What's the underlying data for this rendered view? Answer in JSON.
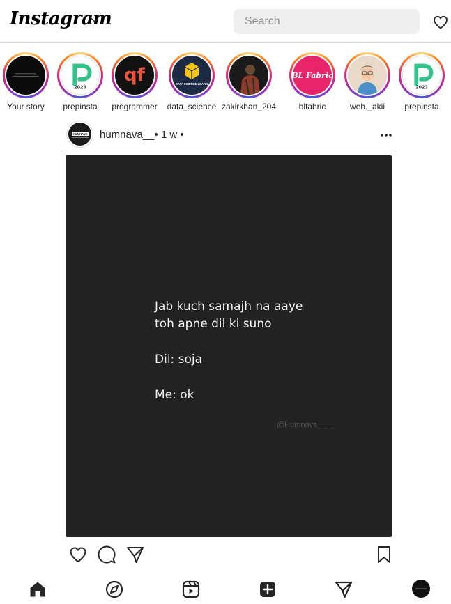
{
  "header": {
    "logo_text": "Instagram",
    "search_placeholder": "Search"
  },
  "stories": [
    {
      "label": "Your story",
      "avatar_icon": "dark-text-avatar"
    },
    {
      "label": "prepinsta",
      "avatar_icon": "prepinsta-logo",
      "badge": "2023"
    },
    {
      "label": "programmer",
      "avatar_icon": "programmer-logo",
      "logo_text": "qf"
    },
    {
      "label": "data_science",
      "avatar_icon": "data-science-logo",
      "logo_text": "DATA SCIENCE LEARN"
    },
    {
      "label": "zakirkhan_204",
      "avatar_icon": "person-photo"
    },
    {
      "label": "blfabric",
      "avatar_icon": "blfabric-logo",
      "logo_text": "BL Fabric"
    },
    {
      "label": "web._akii",
      "avatar_icon": "cartoon-avatar"
    },
    {
      "label": "prepinsta",
      "avatar_icon": "prepinsta-logo",
      "badge": "2023"
    }
  ],
  "post": {
    "username": "humnava__",
    "time": "• 1 w •",
    "avatar_text": "HUMNAVA",
    "text_lines": [
      "Jab kuch samajh na aaye",
      "toh apne dil ki suno",
      "",
      "Dil: soja",
      "",
      "Me: ok"
    ],
    "watermark": "@Humnava_ _ _"
  },
  "nav": [
    "home-icon",
    "explore-icon",
    "reels-icon",
    "create-icon",
    "direct-icon",
    "profile-avatar"
  ],
  "colors": {
    "post_background": "#222222",
    "search_background": "#efefef",
    "story_ring": "#d62976",
    "text": "#262626"
  }
}
